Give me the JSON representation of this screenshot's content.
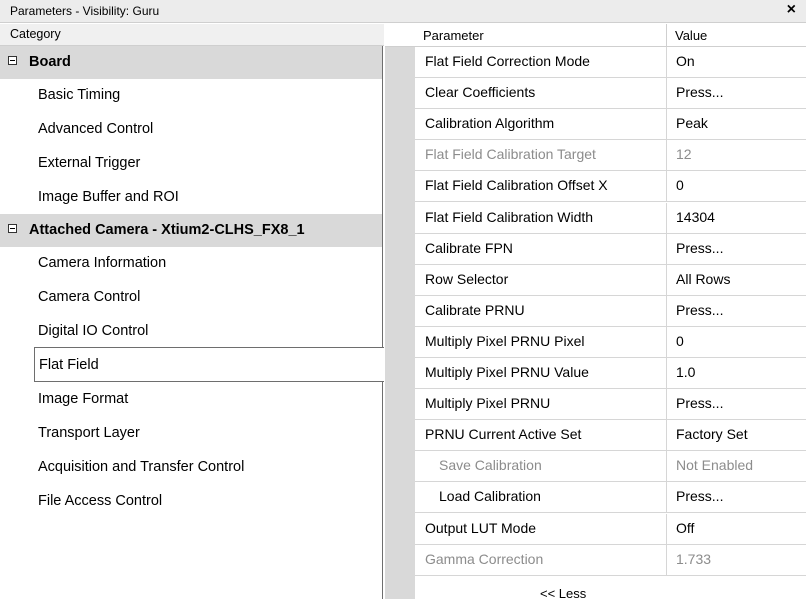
{
  "window": {
    "title": "Parameters - Visibility: Guru",
    "close_label": "×"
  },
  "left": {
    "header": "Category",
    "categories": [
      {
        "label": "Board",
        "type": "group"
      },
      {
        "label": "Basic Timing",
        "type": "item"
      },
      {
        "label": "Advanced Control",
        "type": "item"
      },
      {
        "label": "External Trigger",
        "type": "item"
      },
      {
        "label": "Image Buffer and ROI",
        "type": "item"
      },
      {
        "label": "Attached Camera - Xtium2-CLHS_FX8_1",
        "type": "group"
      },
      {
        "label": "Camera Information",
        "type": "item"
      },
      {
        "label": "Camera Control",
        "type": "item"
      },
      {
        "label": "Digital IO Control",
        "type": "item"
      },
      {
        "label": "Flat Field",
        "type": "item",
        "selected": true
      },
      {
        "label": "Image Format",
        "type": "item"
      },
      {
        "label": "Transport Layer",
        "type": "item"
      },
      {
        "label": "Acquisition and Transfer Control",
        "type": "item"
      },
      {
        "label": "File Access Control",
        "type": "item"
      }
    ]
  },
  "right": {
    "header_parameter": "Parameter",
    "header_value": "Value",
    "rows": [
      {
        "param": "Flat Field Correction Mode",
        "value": "On"
      },
      {
        "param": "Clear Coefficients",
        "value": "Press..."
      },
      {
        "param": "Calibration Algorithm",
        "value": "Peak"
      },
      {
        "param": "Flat Field Calibration Target",
        "value": "12",
        "disabled": true
      },
      {
        "param": "Flat Field Calibration Offset X",
        "value": "0"
      },
      {
        "param": "Flat Field Calibration Width",
        "value": "14304"
      },
      {
        "param": "Calibrate FPN",
        "value": "Press..."
      },
      {
        "param": "Row Selector",
        "value": "All Rows"
      },
      {
        "param": "Calibrate PRNU",
        "value": "Press..."
      },
      {
        "param": "Multiply Pixel PRNU Pixel",
        "value": "0"
      },
      {
        "param": "Multiply Pixel PRNU Value",
        "value": "1.0"
      },
      {
        "param": "Multiply Pixel PRNU",
        "value": "Press..."
      },
      {
        "param": "PRNU Current Active Set",
        "value": "Factory Set"
      },
      {
        "param": "Save Calibration",
        "value": "Not Enabled",
        "disabled": true,
        "indent": true
      },
      {
        "param": "Load Calibration",
        "value": "Press...",
        "indent": true
      },
      {
        "param": "Output LUT Mode",
        "value": "Off"
      },
      {
        "param": "Gamma Correction",
        "value": "1.733",
        "disabled": true
      }
    ],
    "less_label": "<< Less"
  }
}
